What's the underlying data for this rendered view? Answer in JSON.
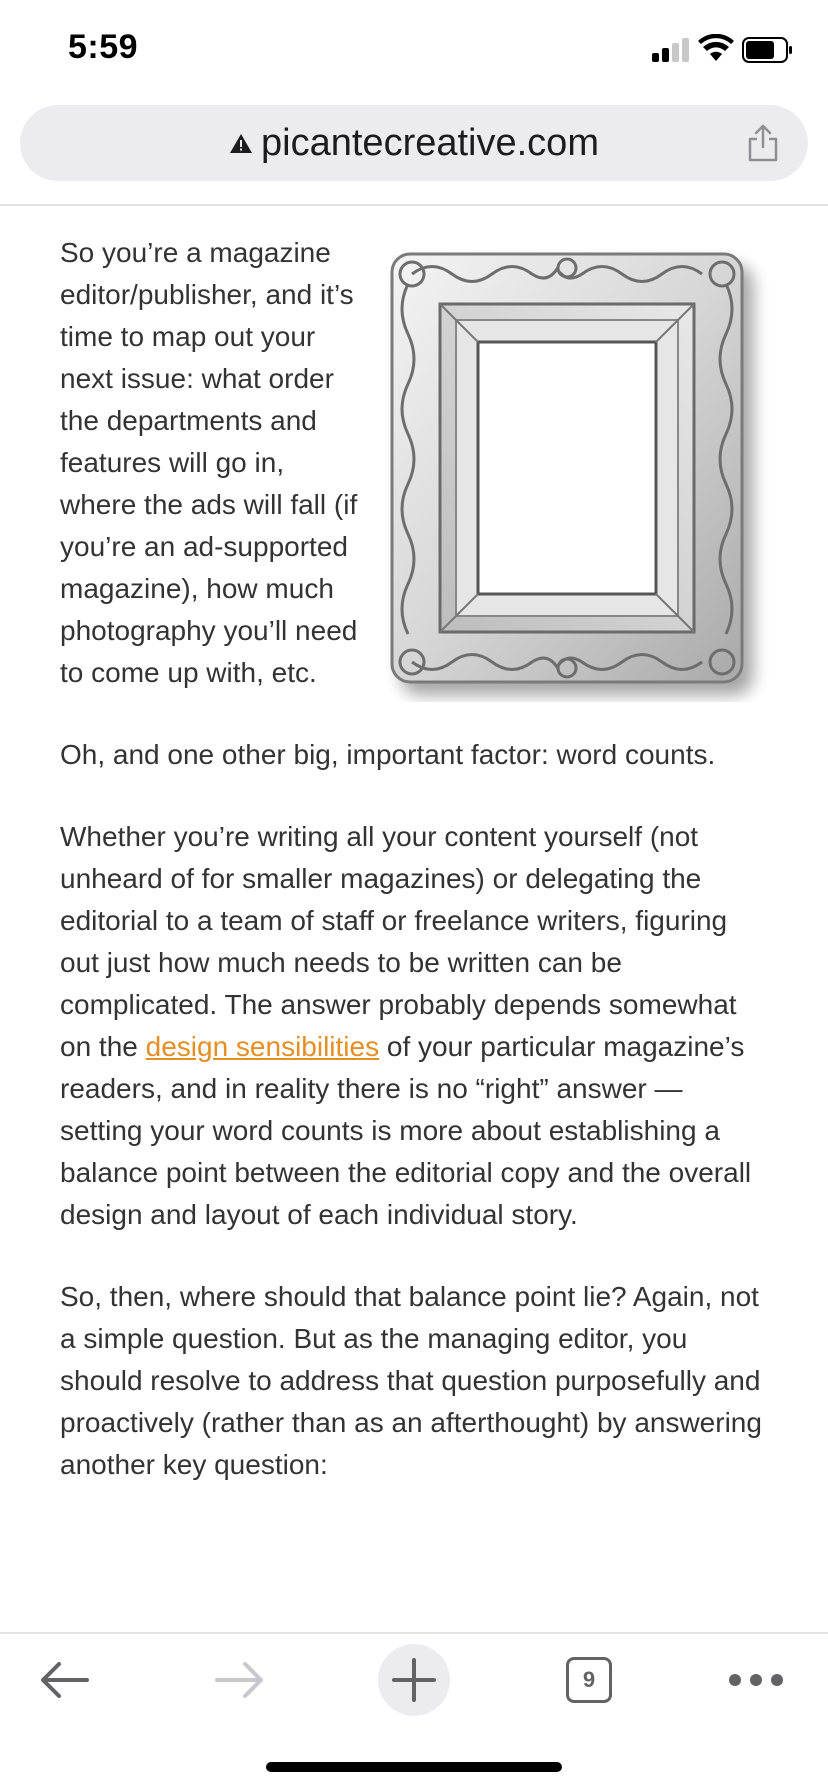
{
  "status_bar": {
    "time": "5:59",
    "signal_icon": "cellular-signal-icon",
    "wifi_icon": "wifi-icon",
    "battery_icon": "battery-icon"
  },
  "browser": {
    "url": "picantecreative.com",
    "security_icon": "warning-triangle-icon",
    "share_icon": "share-icon",
    "tab_count": "9"
  },
  "article": {
    "image_alt": "ornate-picture-frame",
    "p1": "So you’re a magazine editor/publisher, and it’s time to map out your next issue: what order the departments and features will go in, where the ads will fall (if you’re an ad-supported magazine), how much photography you’ll need to come up with, etc.",
    "p2": "Oh, and one other big, important factor: word counts.",
    "p3_before_link": "Whether you’re writing all your content yourself (not unheard of for smaller magazines) or delegating the editorial to a team of staff or freelance writers, figuring out just how much needs to be written can be complicated. The answer probably depends somewhat on the ",
    "p3_link": "design sensibilities",
    "p3_after_link": " of your particular magazine’s readers, and in reality there is no “right” answer — setting your word counts is more about establishing a balance point between the editorial copy and the overall design and layout of each individual story.",
    "p4": "So, then, where should that balance point lie? Again, not a simple question. But as the managing editor, you should resolve to address that question purposefully and proactively (rather than as an afterthought) by answering another key question:"
  },
  "colors": {
    "link": "#e58e24",
    "text": "#333333",
    "url_bar_bg": "#ececee"
  },
  "toolbar": {
    "back_icon": "back-arrow-icon",
    "forward_icon": "forward-arrow-icon",
    "new_tab_icon": "plus-icon",
    "tabs_icon": "tabs-icon",
    "more_icon": "more-dots-icon"
  }
}
